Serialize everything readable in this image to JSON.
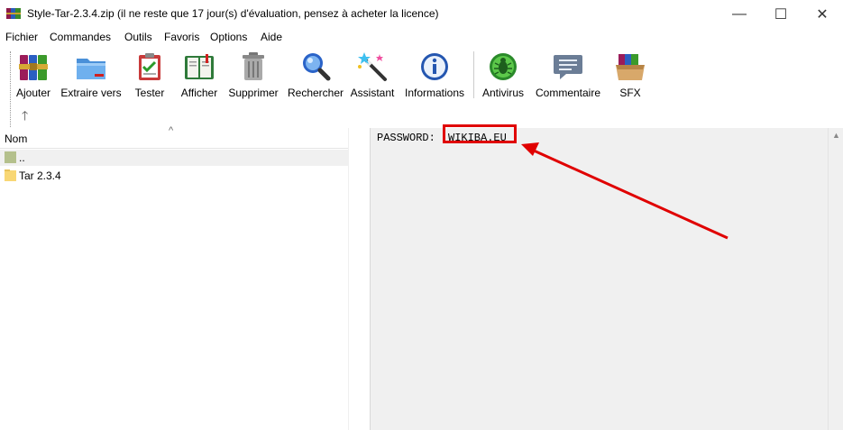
{
  "window": {
    "title": "Style-Tar-2.3.4.zip (il ne reste que 17 jour(s) d'évaluation, pensez à acheter la licence)",
    "controls": {
      "minimize": "—",
      "maximize": "☐",
      "close": "✕"
    }
  },
  "menu": [
    "Fichier",
    "Commandes",
    "Outils",
    "Favoris",
    "Options",
    "Aide"
  ],
  "toolbar": {
    "buttons": [
      {
        "label": "Ajouter",
        "icon": "books-add-icon"
      },
      {
        "label": "Extraire vers",
        "icon": "folder-extract-icon"
      },
      {
        "label": "Tester",
        "icon": "clipboard-check-icon"
      },
      {
        "label": "Afficher",
        "icon": "open-book-icon"
      },
      {
        "label": "Supprimer",
        "icon": "trash-can-icon"
      },
      {
        "label": "Rechercher",
        "icon": "magnifier-icon"
      },
      {
        "label": "Assistant",
        "icon": "magic-wand-icon"
      },
      {
        "label": "Informations",
        "icon": "info-icon"
      },
      {
        "label": "Antivirus",
        "icon": "bug-icon"
      },
      {
        "label": "Commentaire",
        "icon": "speech-bubble-icon"
      },
      {
        "label": "SFX",
        "icon": "sfx-box-icon"
      }
    ],
    "up_arrow": "🡑"
  },
  "file_list": {
    "column_header": "Nom",
    "sort_caret": "^",
    "rows": [
      {
        "name": "..",
        "type": "parent"
      },
      {
        "name": "Tar 2.3.4",
        "type": "folder"
      }
    ]
  },
  "comment": {
    "label": "PASSWORD:",
    "value": "WIKIBA.EU"
  },
  "colors": {
    "highlight_red": "#e00000",
    "comment_bg": "#f0f0f0"
  }
}
